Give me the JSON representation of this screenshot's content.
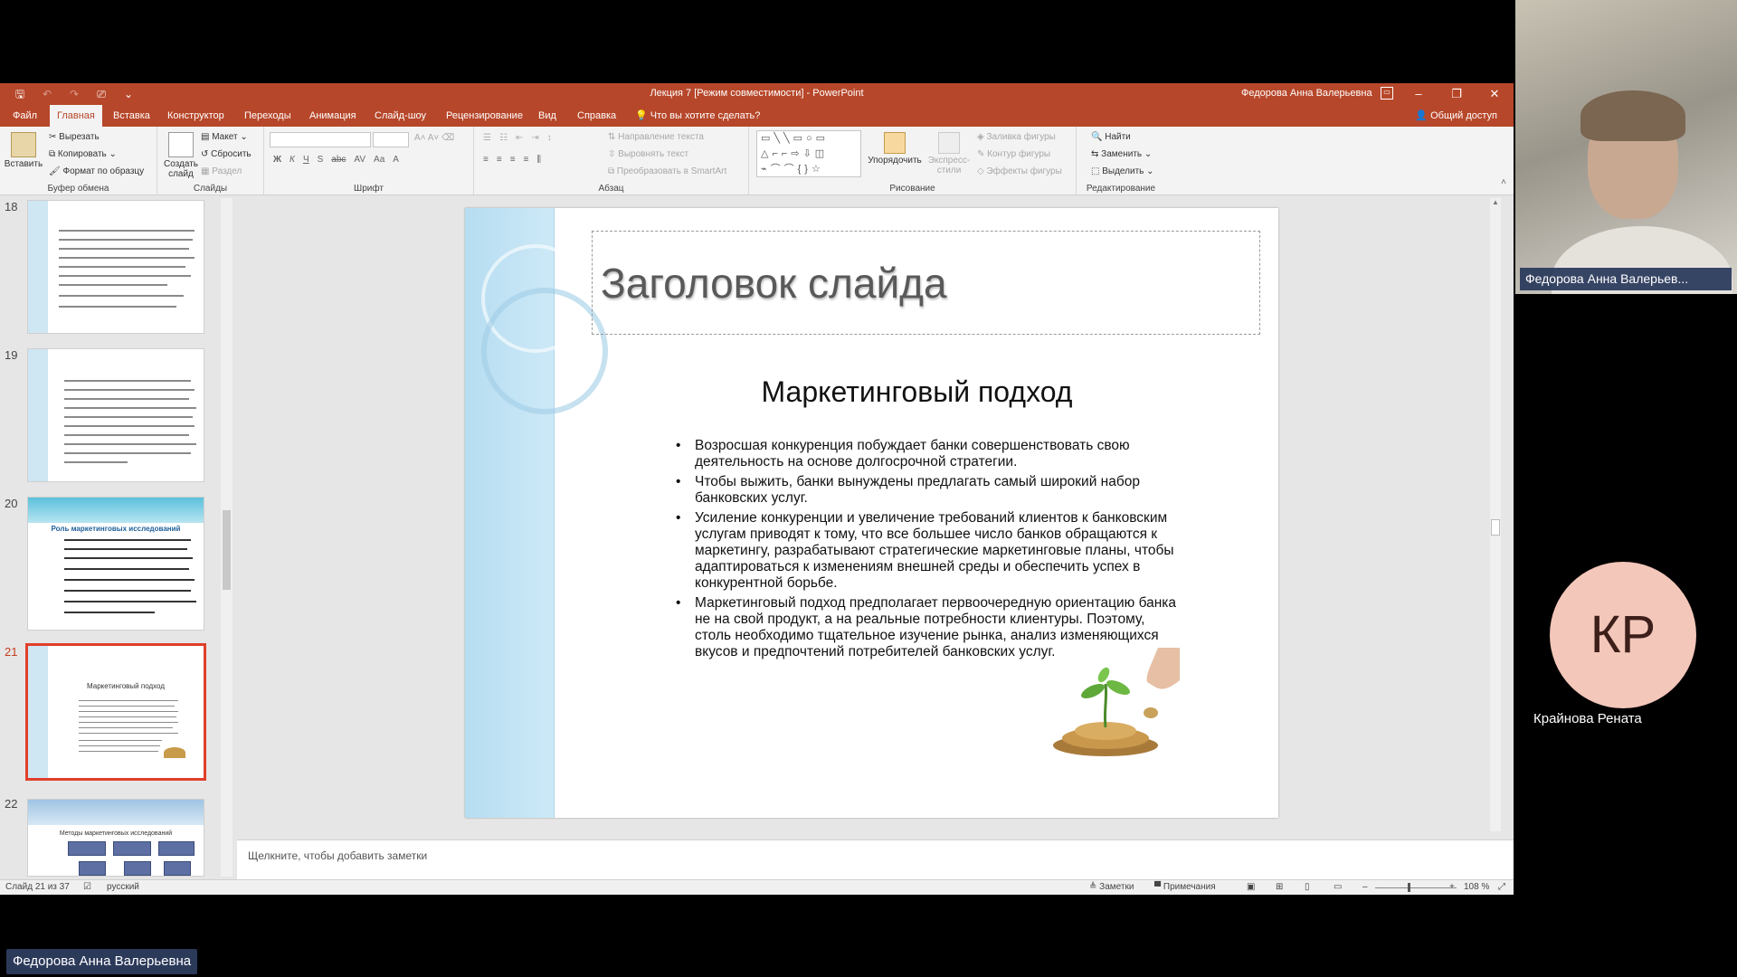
{
  "window": {
    "title": "Лекция 7 [Режим совместимости]  -  PowerPoint",
    "user": "Федорова Анна Валерьевна",
    "controls": {
      "minimize": "–",
      "maximize": "❐",
      "close": "✕"
    }
  },
  "quick_access": {
    "save": "🖫",
    "undo": "↶",
    "redo": "↷",
    "present": "⎚",
    "more": "⌄"
  },
  "menu": {
    "tabs": [
      "Файл",
      "Главная",
      "Вставка",
      "Конструктор",
      "Переходы",
      "Анимация",
      "Слайд-шоу",
      "Рецензирование",
      "Вид",
      "Справка"
    ],
    "active": "Главная",
    "tell_me": "Что вы хотите сделать?",
    "share": "Общий доступ"
  },
  "ribbon": {
    "clipboard": {
      "label": "Буфер обмена",
      "paste": "Вставить",
      "cut": "Вырезать",
      "copy": "Копировать",
      "format_painter": "Формат по образцу"
    },
    "slides": {
      "label": "Слайды",
      "new_slide": "Создать слайд",
      "layout": "Макет",
      "reset": "Сбросить",
      "section": "Раздел"
    },
    "font": {
      "label": "Шрифт",
      "buttons": [
        "Ж",
        "К",
        "Ч",
        "S",
        "abc",
        "AV",
        "Aa"
      ]
    },
    "paragraph": {
      "label": "Абзац",
      "text_direction": "Направление текста",
      "align_text": "Выровнять текст",
      "smartart": "Преобразовать в SmartArt"
    },
    "drawing": {
      "label": "Рисование",
      "arrange": "Упорядочить",
      "quick_styles": "Экспресс-стили",
      "shape_fill": "Заливка фигуры",
      "shape_outline": "Контур фигуры",
      "shape_effects": "Эффекты фигуры"
    },
    "editing": {
      "label": "Редактирование",
      "find": "Найти",
      "replace": "Заменить",
      "select": "Выделить"
    }
  },
  "thumbnails": [
    {
      "number": "18"
    },
    {
      "number": "19"
    },
    {
      "number": "20",
      "title": "Роль маркетинговых исследований"
    },
    {
      "number": "21",
      "title": "Маркетинговый подход",
      "active": true
    },
    {
      "number": "22",
      "title": "Методы маркетинговых исследований"
    }
  ],
  "slide": {
    "title_placeholder": "Заголовок слайда",
    "heading": "Маркетинговый подход",
    "bullets": [
      "Возросшая конкуренция побуждает банки совершенствовать свою деятельность на основе долгосрочной стратегии.",
      "Чтобы выжить, банки вынуждены предлагать самый широкий набор банковских услуг.",
      "Усиление конкуренции и увеличение требований клиентов к банковским услугам приводят к тому, что все большее число банков обращаются к маркетингу, разрабатывают стратегические маркетинговые планы, чтобы адаптироваться к изменениям внешней среды и обеспечить успех в конкурентной борьбе.",
      "Маркетинговый подход предполагает первоочередную ориентацию банка не на свой продукт, а на реальные потребности клиентуры. Поэтому, столь необходимо тщательное изучение рынка, анализ изменяющихся вкусов и предпочтений потребителей банковских услуг."
    ]
  },
  "notes_placeholder": "Щелкните, чтобы добавить заметки",
  "status": {
    "slide_counter": "Слайд 21 из 37",
    "language": "русский",
    "notes": "Заметки",
    "comments": "Примечания",
    "zoom": "108 %"
  },
  "participants": {
    "presenter_tile": "Федорова Анна Валерьев...",
    "other_initials": "КР",
    "other_name": "Крайнова Рената",
    "bottom_label": "Федорова Анна Валерьевна"
  },
  "colors": {
    "accent": "#b7472a",
    "slide_band": "#cde9f7",
    "thumb_active": "#e03f2a",
    "avatar_bg": "#f3c7ba"
  }
}
